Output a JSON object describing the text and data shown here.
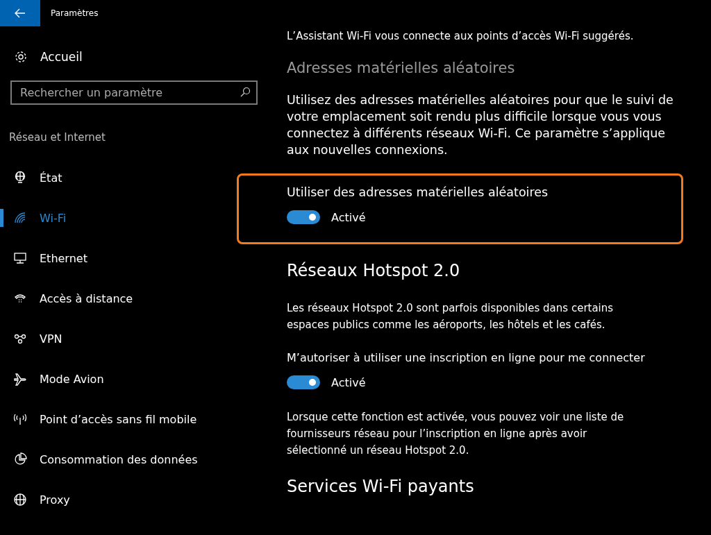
{
  "window": {
    "title": "Paramètres"
  },
  "sidebar": {
    "home": "Accueil",
    "search": {
      "placeholder": "Rechercher un paramètre"
    },
    "section": "Réseau et Internet",
    "items": [
      {
        "label": "État",
        "selected": false
      },
      {
        "label": "Wi-Fi",
        "selected": true
      },
      {
        "label": "Ethernet",
        "selected": false
      },
      {
        "label": "Accès à distance",
        "selected": false
      },
      {
        "label": "VPN",
        "selected": false
      },
      {
        "label": "Mode Avion",
        "selected": false
      },
      {
        "label": "Point d’accès sans fil mobile",
        "selected": false
      },
      {
        "label": "Consommation des données",
        "selected": false
      },
      {
        "label": "Proxy",
        "selected": false
      }
    ]
  },
  "content": [
    {
      "kind": "text",
      "text": "L’Assistant Wi-Fi vous connecte aux points d’accès Wi-Fi suggérés."
    },
    {
      "kind": "subheading",
      "text": "Adresses matérielles aléatoires"
    },
    {
      "kind": "lead",
      "text": "Utilisez des adresses matérielles aléatoires pour que le suivi de votre emplacement soit rendu plus difficile lorsque vous vous connectez à différents réseaux Wi-Fi. Ce paramètre s’applique aux nouvelles connexions."
    },
    {
      "kind": "toggle",
      "label": "Utiliser des adresses matérielles aléatoires",
      "state_text": "Activé",
      "on": true,
      "highlighted": true
    },
    {
      "kind": "heading",
      "text": "Réseaux Hotspot 2.0"
    },
    {
      "kind": "text",
      "text": "Les réseaux Hotspot 2.0 sont parfois disponibles dans certains espaces publics comme les aéroports, les hôtels et les cafés."
    },
    {
      "kind": "toggle",
      "label": "M’autoriser à utiliser une inscription en ligne pour me connecter",
      "state_text": "Activé",
      "on": true,
      "highlighted": false
    },
    {
      "kind": "text",
      "text": "Lorsque cette fonction est activée, vous pouvez voir une liste de fournisseurs réseau pour l’inscription en ligne après avoir sélectionné un réseau Hotspot 2.0."
    },
    {
      "kind": "heading",
      "text": "Services Wi-Fi payants"
    }
  ]
}
